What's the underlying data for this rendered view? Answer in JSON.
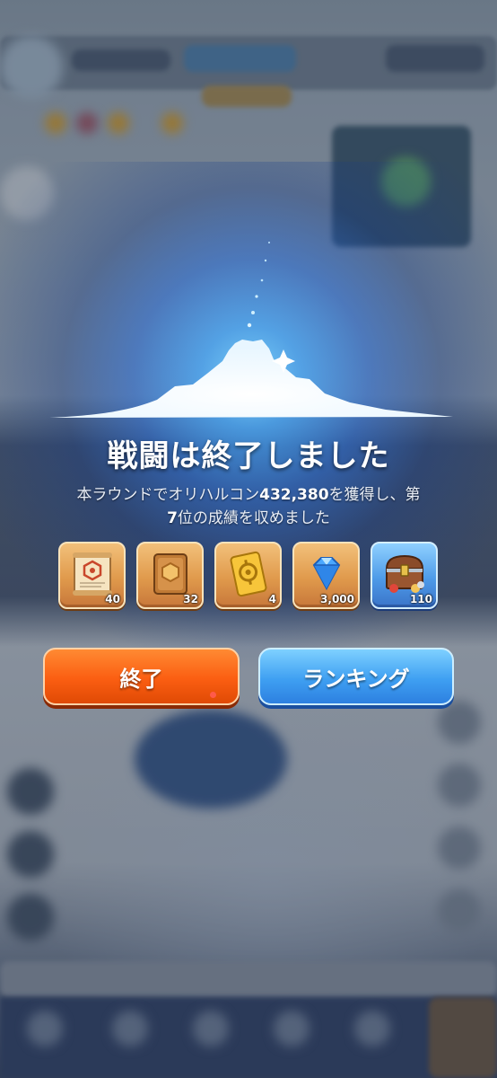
{
  "dialog": {
    "title": "戦闘は終了しました",
    "description_prefix": "本ラウンドでオリハルコン",
    "amount": "432,380",
    "description_mid": "を獲得し、第",
    "rank": "7",
    "description_suffix": "位の成績を収めました"
  },
  "rewards": [
    {
      "icon": "scroll-icon",
      "quantity": "40"
    },
    {
      "icon": "book-icon",
      "quantity": "32"
    },
    {
      "icon": "gold-ticket-icon",
      "quantity": "4"
    },
    {
      "icon": "diamond-icon",
      "quantity": "3,000"
    },
    {
      "icon": "treasure-chest-icon",
      "quantity": "110"
    }
  ],
  "buttons": {
    "exit_label": "終了",
    "ranking_label": "ランキング"
  },
  "colors": {
    "exit_button": "#fb5e12",
    "ranking_button": "#3fa0f2",
    "reward_tile": "#e09a4c",
    "reward_tile_highlight": "#4e9be8"
  }
}
